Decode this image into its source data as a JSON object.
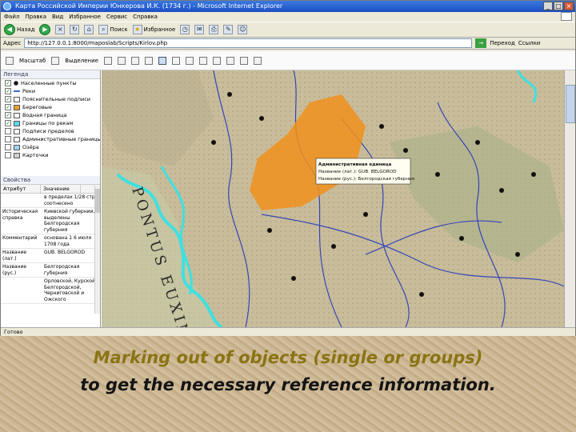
{
  "window": {
    "title": "Карта Российской Империи Юнкерова И.К. (1734 г.) - Microsoft Internet Explorer",
    "min": "_",
    "max": "□",
    "close": "×"
  },
  "menu": [
    "Файл",
    "Правка",
    "Вид",
    "Избранное",
    "Сервис",
    "Справка"
  ],
  "toolbar": {
    "back": "Назад",
    "search": "Поиск",
    "favorites": "Избранное"
  },
  "address": {
    "label": "Адрес",
    "url": "http://127.0.0.1:8000/maposlab/Scripts/Kirlov.php",
    "go": "Переход",
    "links": "Ссылки"
  },
  "maptools": {
    "scale_label": "Масштаб",
    "mode_label": "Выделение"
  },
  "legend": {
    "title": "Легенда",
    "items": [
      {
        "label": "Населенные пункты",
        "swatch": "#111111",
        "shape": "dot",
        "checked": true
      },
      {
        "label": "Реки",
        "swatch": "#3b6fc7",
        "shape": "line",
        "checked": true
      },
      {
        "label": "Пояснительные подписи",
        "swatch": "#ffffff",
        "shape": "box",
        "checked": true
      },
      {
        "label": "Береговые",
        "swatch": "#e8a030",
        "shape": "box",
        "checked": true
      },
      {
        "label": "Водная граница",
        "swatch": "#ffffff",
        "shape": "box",
        "checked": true
      },
      {
        "label": "Границы по рекам",
        "swatch": "#5fd7e8",
        "shape": "box",
        "checked": true
      },
      {
        "label": "Подписи пределов",
        "swatch": "#ffffff",
        "shape": "box",
        "checked": false
      },
      {
        "label": "Административные границы",
        "swatch": "#ffffff",
        "shape": "box",
        "checked": false
      },
      {
        "label": "Озёра",
        "swatch": "#9fd3ef",
        "shape": "box",
        "checked": false
      },
      {
        "label": "Карточки",
        "swatch": "#cfcfcf",
        "shape": "box",
        "checked": false
      }
    ]
  },
  "properties": {
    "title": "Свойства",
    "col_attr": "Атрибут",
    "col_value": "Значение",
    "rows": [
      {
        "k": "",
        "v": "в пределах 1/28 стр., соотнесено"
      },
      {
        "k": "Историческая справка",
        "v": "Киевской губернии, выделены Белгородская губерния"
      },
      {
        "k": "Комментарий",
        "v": "основана 1 6 июля 1708 года"
      },
      {
        "k": "Название (лат.)",
        "v": "GUB. BELGOROD"
      },
      {
        "k": "Название (рус.)",
        "v": "Белгородская губерния"
      },
      {
        "k": "",
        "v": "Орловской, Курской, Белгородской, Черниговской и Ожского"
      }
    ]
  },
  "map": {
    "popup_lines": [
      "Административная единица",
      "Название (лат.): GUB. BELGOROD",
      "Название (рус.): Белгородская губерния"
    ],
    "sea_label": "PONTUS EUXINUS",
    "colors": {
      "highlight": "#f0901c",
      "coast": "#3fe0e0",
      "river": "#3546b8",
      "paper": "#c8bc9a"
    }
  },
  "status": {
    "text": "Готово"
  },
  "caption": {
    "line1": "Marking out of objects (single or groups)",
    "line2": "to get the necessary reference information."
  }
}
